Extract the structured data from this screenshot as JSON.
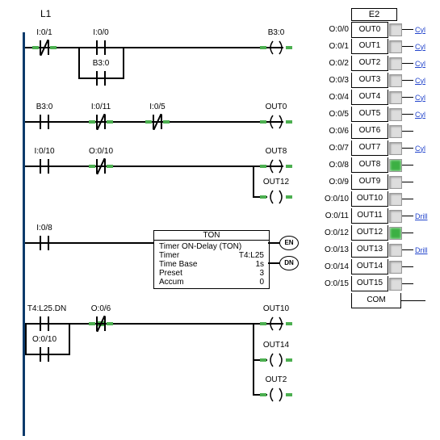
{
  "ladder": {
    "title": "L1",
    "rungs": [
      {
        "contacts": [
          {
            "label": "I:0/1",
            "type": "NC"
          },
          {
            "label": "I:0/0",
            "type": "NO"
          }
        ],
        "branch_contact": {
          "label": "B3:0",
          "type": "NO"
        },
        "outputs": [
          {
            "label": "B3:0"
          }
        ]
      },
      {
        "contacts": [
          {
            "label": "B3:0",
            "type": "NO"
          },
          {
            "label": "I:0/11",
            "type": "NC"
          },
          {
            "label": "I:0/5",
            "type": "NC"
          }
        ],
        "outputs": [
          {
            "label": "OUT0"
          }
        ]
      },
      {
        "contacts": [
          {
            "label": "I:0/10",
            "type": "NO"
          },
          {
            "label": "O:0/10",
            "type": "NC"
          }
        ],
        "outputs": [
          {
            "label": "OUT8"
          },
          {
            "label": "OUT12"
          }
        ]
      },
      {
        "contacts": [
          {
            "label": "I:0/8",
            "type": "NO"
          }
        ],
        "ton": {
          "title": "TON",
          "desc": "Timer ON-Delay (TON)",
          "timer": "T4:L25",
          "timebase": "1s",
          "preset": "3",
          "accum": "0",
          "pin_en": "EN",
          "pin_dn": "DN"
        }
      },
      {
        "contacts": [
          {
            "label": "T4:L25.DN",
            "type": "NO"
          },
          {
            "label": "O:0/6",
            "type": "NC",
            "powered": true
          }
        ],
        "branch_contact": {
          "label": "O:0/10",
          "type": "NO"
        },
        "outputs": [
          {
            "label": "OUT10"
          },
          {
            "label": "OUT14"
          },
          {
            "label": "OUT2"
          }
        ]
      }
    ],
    "labels": {
      "timer_l": "Timer",
      "timebase_l": "Time Base",
      "preset_l": "Preset",
      "accum_l": "Accum"
    }
  },
  "module": {
    "title": "E2",
    "rows": [
      {
        "addr": "O:0/0",
        "name": "OUT0",
        "on": false,
        "link": "Cyl"
      },
      {
        "addr": "O:0/1",
        "name": "OUT1",
        "on": false,
        "link": "Cyl"
      },
      {
        "addr": "O:0/2",
        "name": "OUT2",
        "on": false,
        "link": "Cyl"
      },
      {
        "addr": "O:0/3",
        "name": "OUT3",
        "on": false,
        "link": "Cyl"
      },
      {
        "addr": "O:0/4",
        "name": "OUT4",
        "on": false,
        "link": "Cyl"
      },
      {
        "addr": "O:0/5",
        "name": "OUT5",
        "on": false,
        "link": "Cyl"
      },
      {
        "addr": "O:0/6",
        "name": "OUT6",
        "on": false,
        "link": ""
      },
      {
        "addr": "O:0/7",
        "name": "OUT7",
        "on": false,
        "link": "Cyl"
      },
      {
        "addr": "O:0/8",
        "name": "OUT8",
        "on": true,
        "link": ""
      },
      {
        "addr": "O:0/9",
        "name": "OUT9",
        "on": false,
        "link": ""
      },
      {
        "addr": "O:0/10",
        "name": "OUT10",
        "on": false,
        "link": ""
      },
      {
        "addr": "O:0/11",
        "name": "OUT11",
        "on": false,
        "link": "Drill"
      },
      {
        "addr": "O:0/12",
        "name": "OUT12",
        "on": true,
        "link": ""
      },
      {
        "addr": "O:0/13",
        "name": "OUT13",
        "on": false,
        "link": "Drill"
      },
      {
        "addr": "O:0/14",
        "name": "OUT14",
        "on": false,
        "link": ""
      },
      {
        "addr": "O:0/15",
        "name": "OUT15",
        "on": false,
        "link": ""
      }
    ],
    "com": "COM"
  }
}
